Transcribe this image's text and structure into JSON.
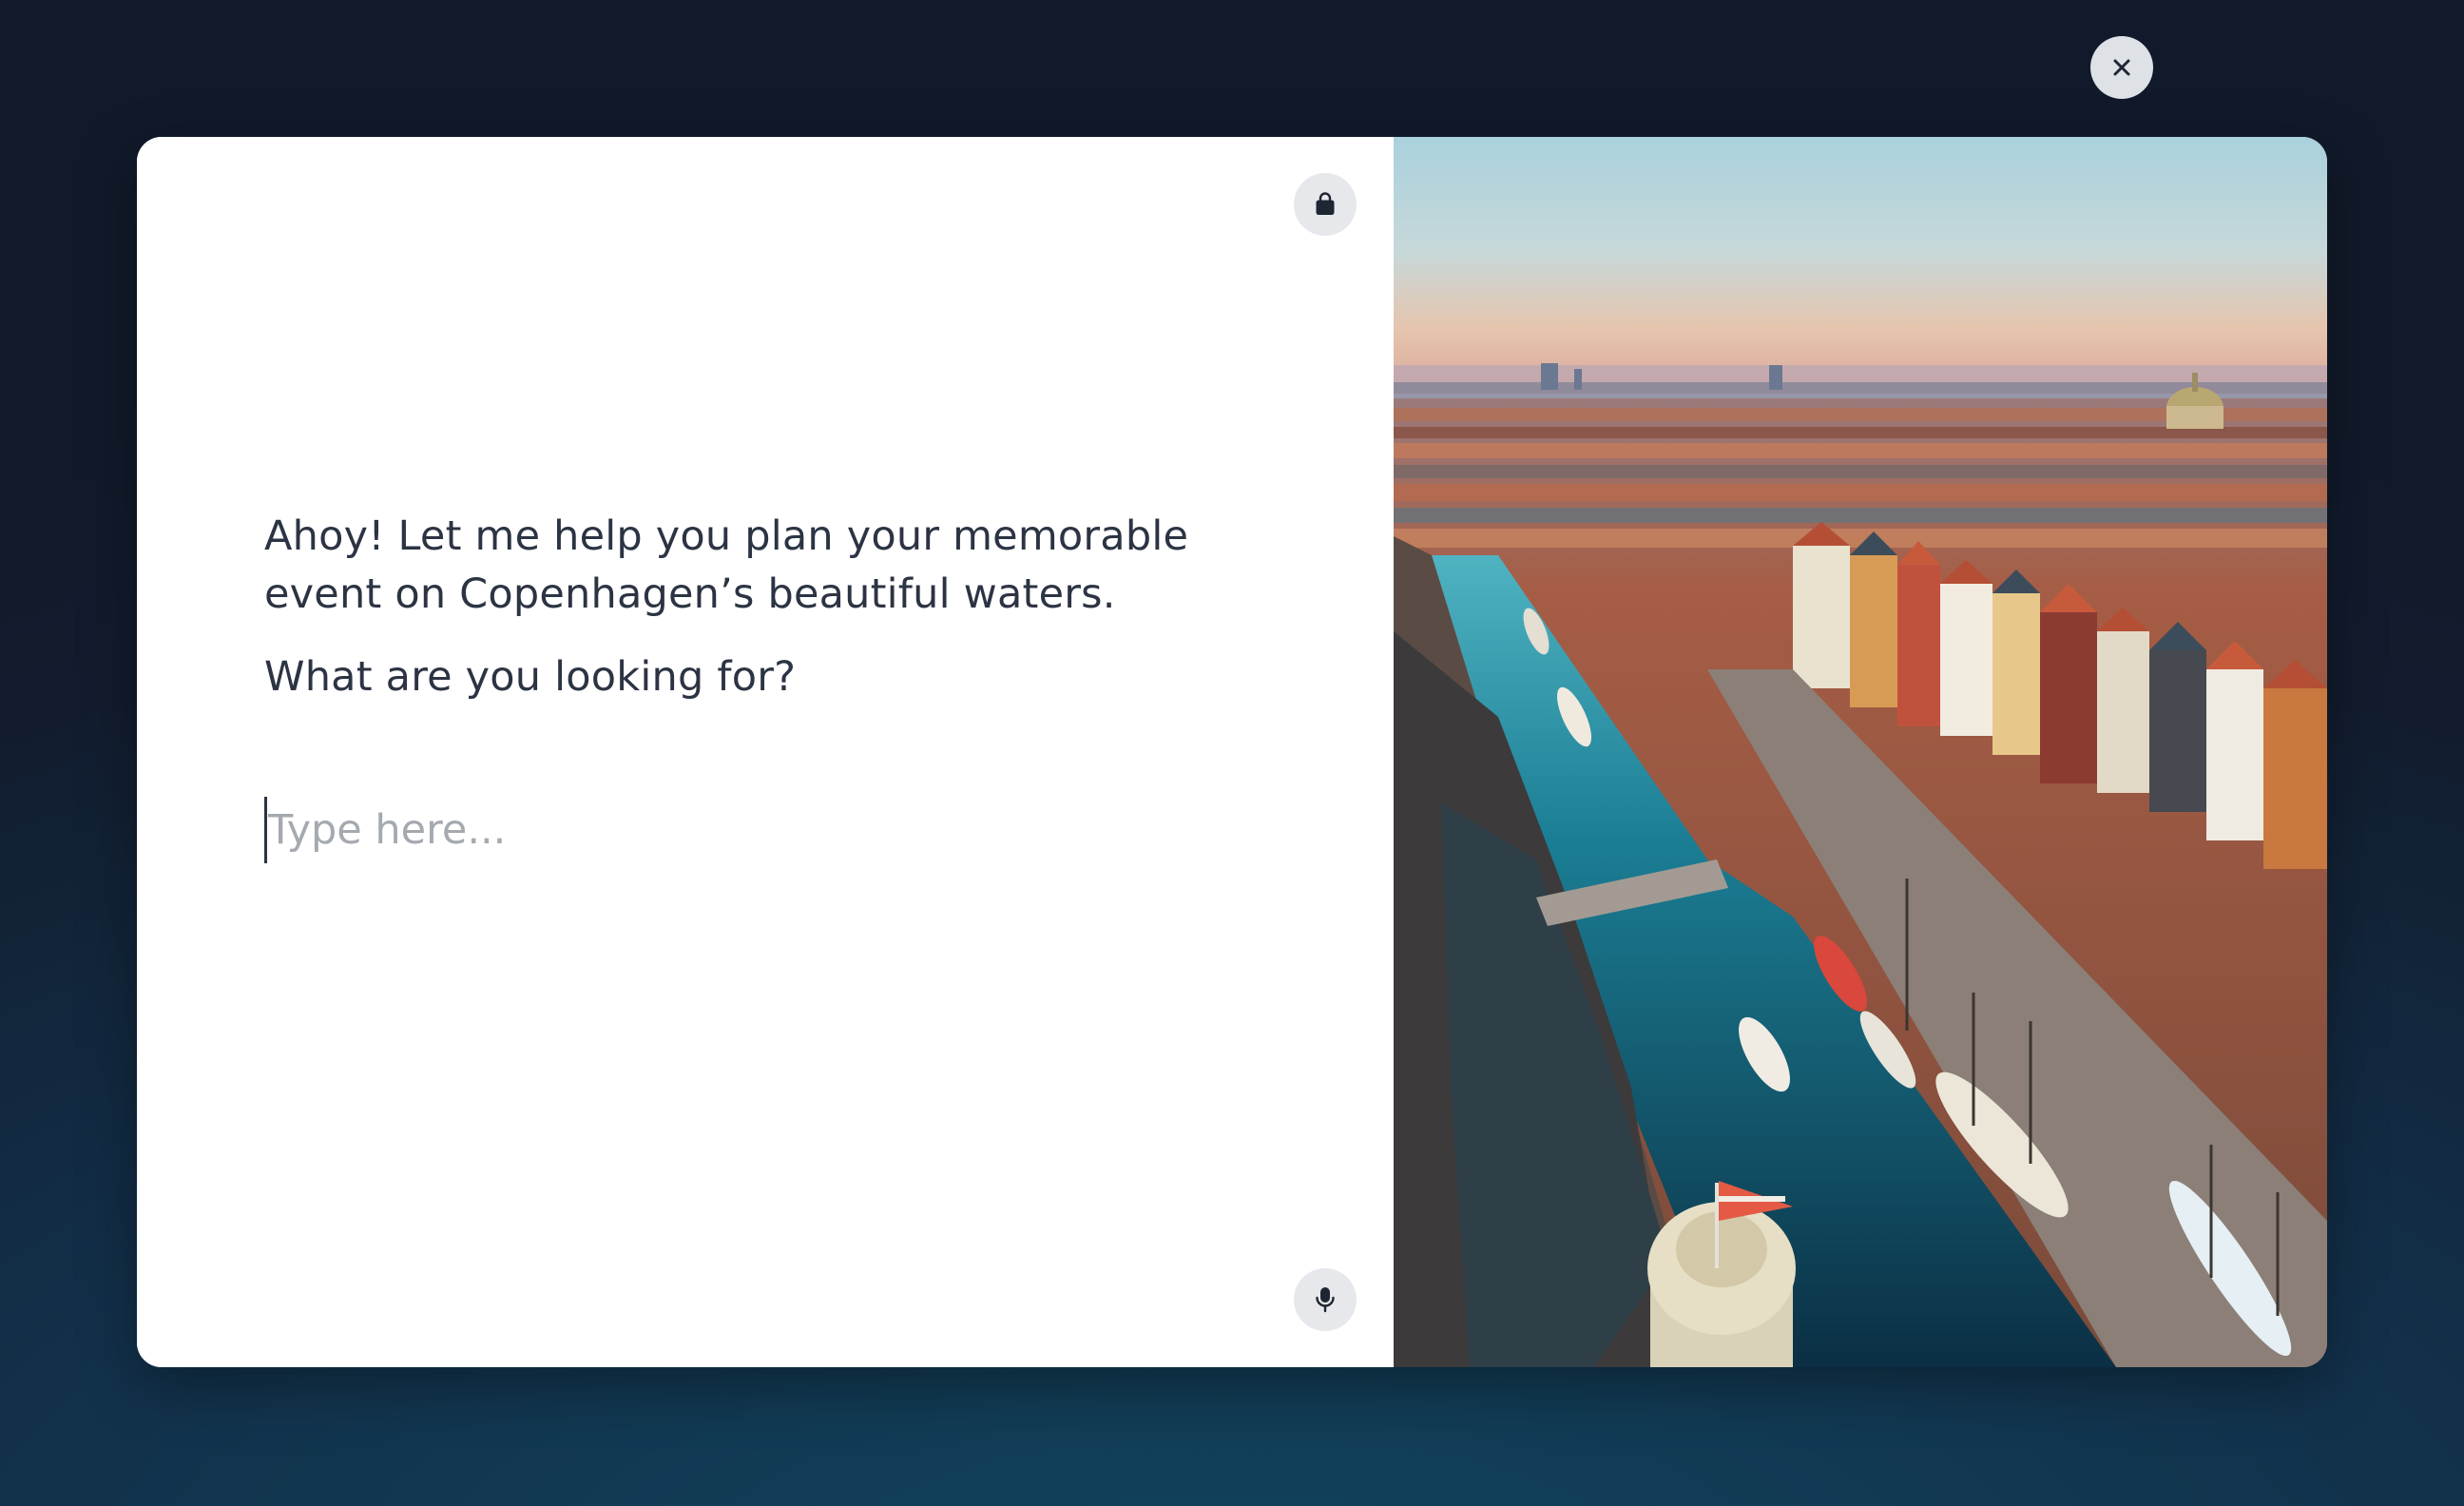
{
  "assistant": {
    "greeting": "Ahoy! Let me help you plan your memorable event on Copenhagen’s beautiful waters.",
    "question": "What are you looking for?"
  },
  "input": {
    "placeholder": "Type here...",
    "value": ""
  },
  "icons": {
    "top_left_panel": "shopping-bag-icon",
    "bottom_left_panel": "microphone-icon",
    "top_right": "close-icon"
  },
  "colors": {
    "background_dark": "#121c2e",
    "background_teal": "#11455e",
    "text": "#2c3443",
    "placeholder": "#a5a9b0",
    "icon_button_bg": "#e6e8eb"
  }
}
